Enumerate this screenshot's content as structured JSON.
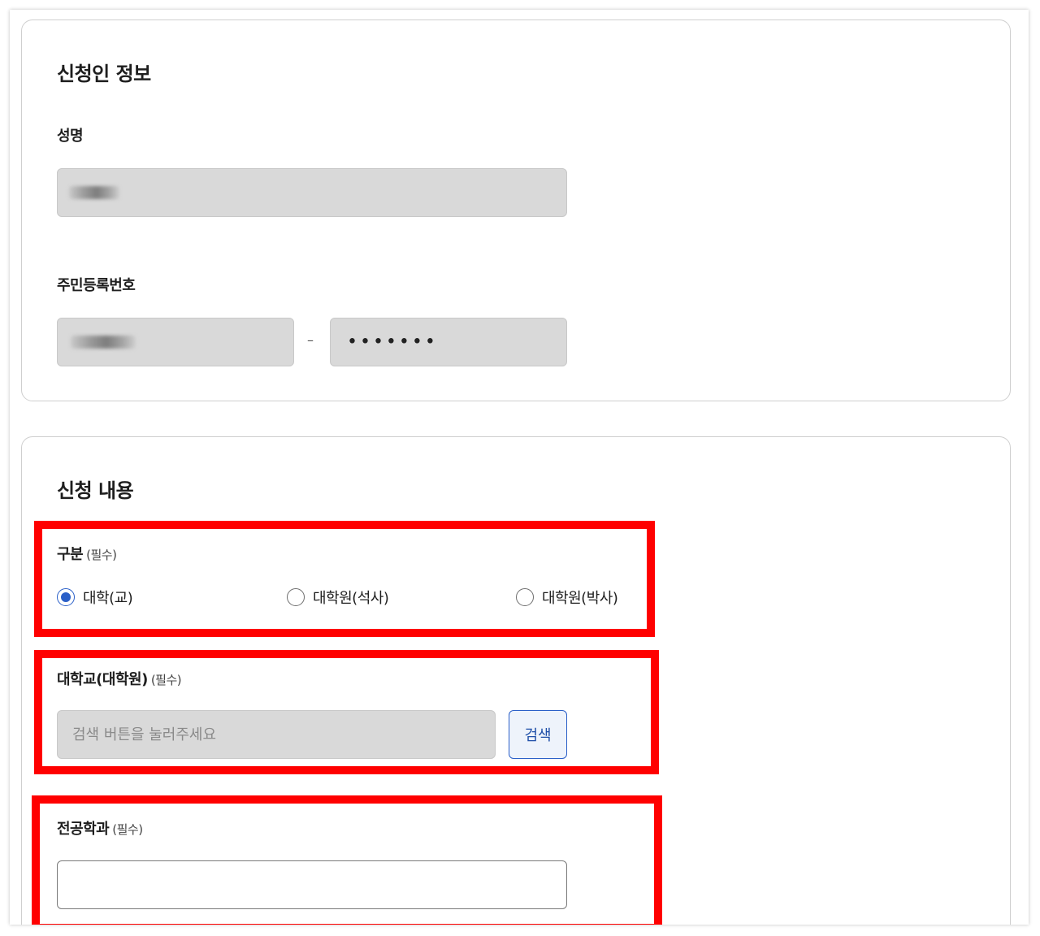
{
  "applicant": {
    "title": "신청인 정보",
    "name_label": "성명",
    "rrn_label": "주민등록번호",
    "rrn_separator": "–",
    "rrn_back": "•••••••"
  },
  "application": {
    "title": "신청 내용",
    "category": {
      "label": "구분",
      "required": "(필수)",
      "options": [
        "대학(교)",
        "대학원(석사)",
        "대학원(박사)"
      ],
      "selected": "대학(교)"
    },
    "university": {
      "label": "대학교(대학원)",
      "required": "(필수)",
      "placeholder": "검색 버튼을 눌러주세요",
      "search_button": "검색"
    },
    "major": {
      "label": "전공학과",
      "required": "(필수)"
    }
  },
  "colors": {
    "highlight": "#ff0000",
    "accent": "#2a5fc8",
    "disabled_field": "#d9d9d9"
  }
}
